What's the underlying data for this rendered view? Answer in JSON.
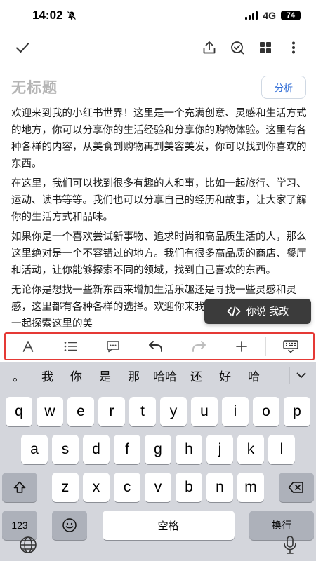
{
  "status": {
    "time": "14:02",
    "network": "4G",
    "battery": "74"
  },
  "editor": {
    "title": "无标题",
    "analyze_label": "分析",
    "paragraphs": [
      "欢迎来到我的小红书世界！这里是一个充满创意、灵感和生活方式的地方，你可以分享你的生活经验和分享你的购物体验。这里有各种各样的内容，从美食到购物再到美容美发，你可以找到你喜欢的东西。",
      "在这里，我们可以找到很多有趣的人和事，比如一起旅行、学习、运动、读书等等。我们也可以分享自己的经历和故事，让大家了解你的生活方式和品味。",
      "如果你是一个喜欢尝试新事物、追求时尚和高品质生活的人，那么这里绝对是一个不容错过的地方。我们有很多高品质的商店、餐厅和活动，让你能够探索不同的领域，找到自己喜欢的东西。",
      "无论你是想找一些新东西来增加生活乐趣还是寻找一些灵感和灵感，这里都有各种各样的选择。欢迎你来我们的小红书世界看看，一起探索这里的美"
    ],
    "tooltip_label": "你说 我改"
  },
  "keyboard": {
    "candidates": [
      "。",
      "我",
      "你",
      "是",
      "那",
      "哈哈",
      "还",
      "好",
      "哈"
    ],
    "row1": [
      "q",
      "w",
      "e",
      "r",
      "t",
      "y",
      "u",
      "i",
      "o",
      "p"
    ],
    "row2": [
      "a",
      "s",
      "d",
      "f",
      "g",
      "h",
      "j",
      "k",
      "l"
    ],
    "row3": [
      "z",
      "x",
      "c",
      "v",
      "b",
      "n",
      "m"
    ],
    "num_label": "123",
    "space_label": "空格",
    "enter_label": "换行"
  },
  "icons": {
    "done": "checkmark-icon",
    "share": "share-icon",
    "review": "review-icon",
    "layout": "grid-icon",
    "more": "more-icon"
  }
}
